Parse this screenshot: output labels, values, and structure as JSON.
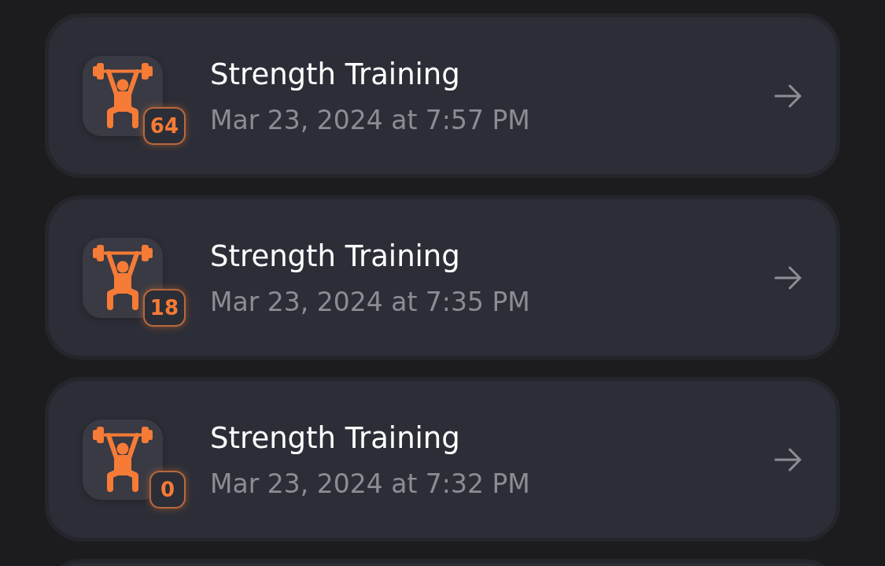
{
  "workouts": [
    {
      "title": "Strength Training",
      "count": "64",
      "date": "Mar 23, 2024 at 7:57 PM"
    },
    {
      "title": "Strength Training",
      "count": "18",
      "date": "Mar 23, 2024 at 7:35 PM"
    },
    {
      "title": "Strength Training",
      "count": "0",
      "date": "Mar 23, 2024 at 7:32 PM"
    }
  ]
}
